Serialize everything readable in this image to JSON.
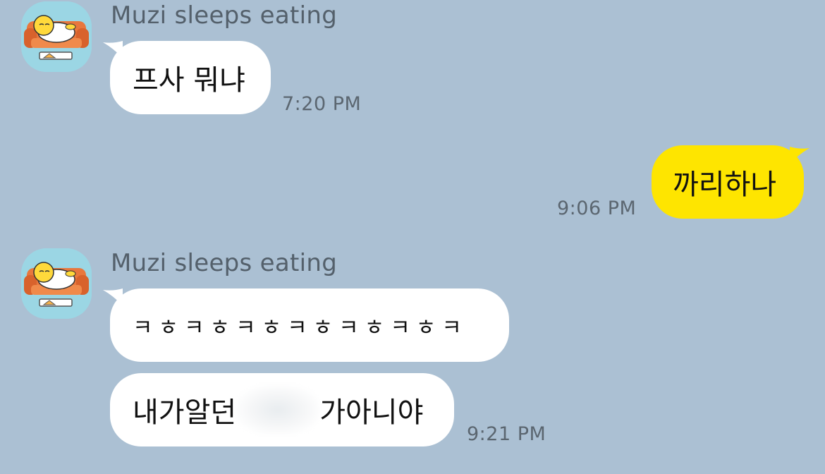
{
  "colors": {
    "background": "#abc0d3",
    "incoming_bubble": "#ffffff",
    "outgoing_bubble": "#fee500",
    "sender_text": "#54606b",
    "time_text": "#5b6670"
  },
  "messages": [
    {
      "sender": "Muzi sleeps eating",
      "avatar_icon": "muzi-sofa-avatar-icon",
      "text": "프사 뭐냐",
      "time": "7:20 PM",
      "direction": "incoming"
    },
    {
      "text": "까리하나",
      "time": "9:06 PM",
      "direction": "outgoing"
    },
    {
      "sender": "Muzi sleeps eating",
      "avatar_icon": "muzi-sofa-avatar-icon",
      "direction": "incoming",
      "bubbles": [
        {
          "text": "ㅋㅎㅋㅎㅋㅎㅋㅎㅋㅎㅋㅎㅋ"
        },
        {
          "text_before": "내가알던",
          "redacted": true,
          "text_after": "가아니야"
        }
      ],
      "time": "9:21 PM"
    }
  ]
}
